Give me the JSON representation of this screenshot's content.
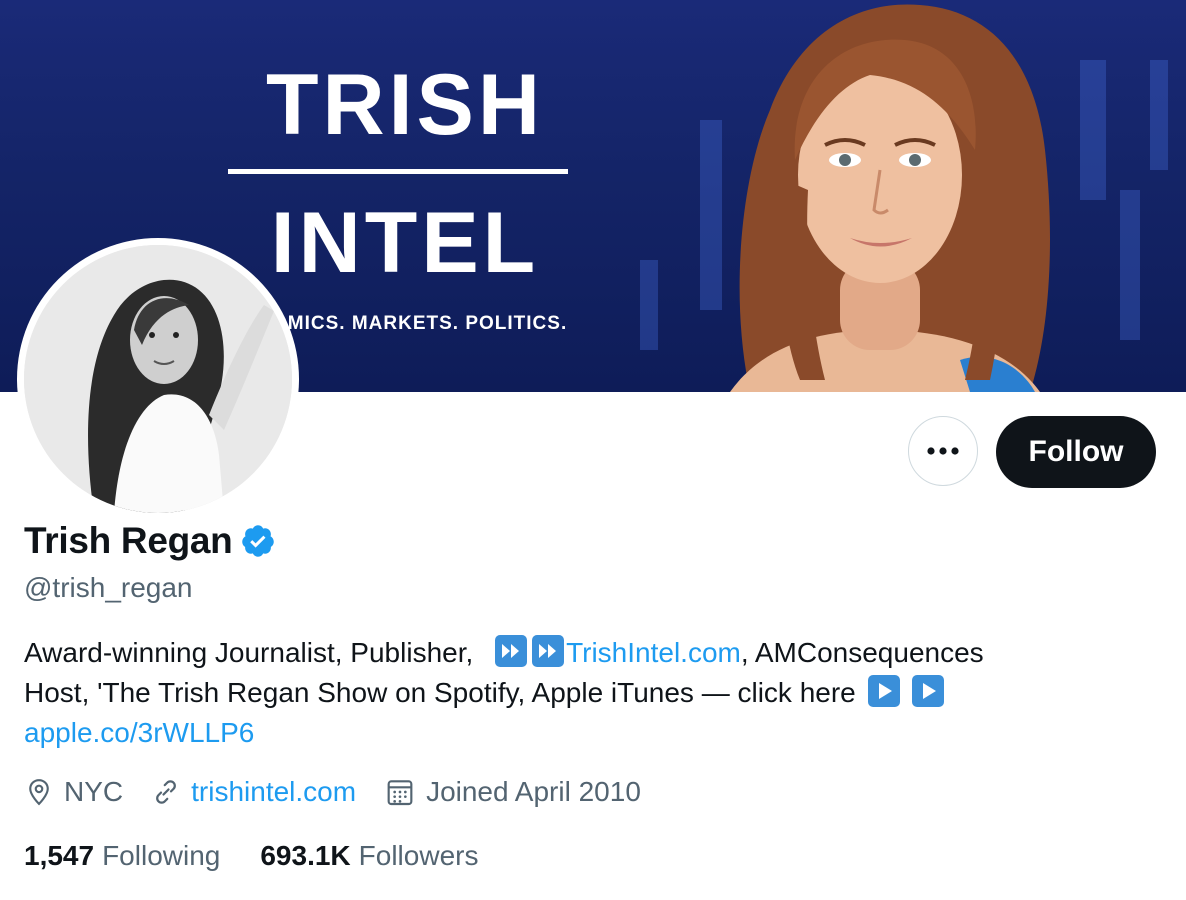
{
  "banner": {
    "title_line1": "TRISH",
    "title_line2": "INTEL",
    "tagline": "OMICS. MARKETS. POLITICS."
  },
  "profile": {
    "name": "Trish Regan",
    "handle": "@trish_regan",
    "verified_icon": "verified-badge-icon",
    "follow_label": "Follow",
    "more_label": "•••"
  },
  "bio": {
    "part1": "Award-winning Journalist, Publisher, ",
    "link1": "TrishIntel.com",
    "part2": ", AMConsequences",
    "part3": "Host, 'The Trish Regan Show on Spotify, Apple iTunes — click here ",
    "link2": "apple.co/3rWLLP6",
    "emoji_fast_forward": "fast-forward-button-icon",
    "emoji_play": "play-button-icon"
  },
  "meta": {
    "location": "NYC",
    "website": "trishintel.com",
    "joined": "Joined April 2010"
  },
  "stats": {
    "following_count": "1,547",
    "following_label": "Following",
    "followers_count": "693.1K",
    "followers_label": "Followers"
  },
  "colors": {
    "link": "#1d9bf0",
    "text": "#0f1419",
    "secondary": "#536471",
    "banner_bg": "#142467",
    "verified": "#1d9bf0"
  }
}
